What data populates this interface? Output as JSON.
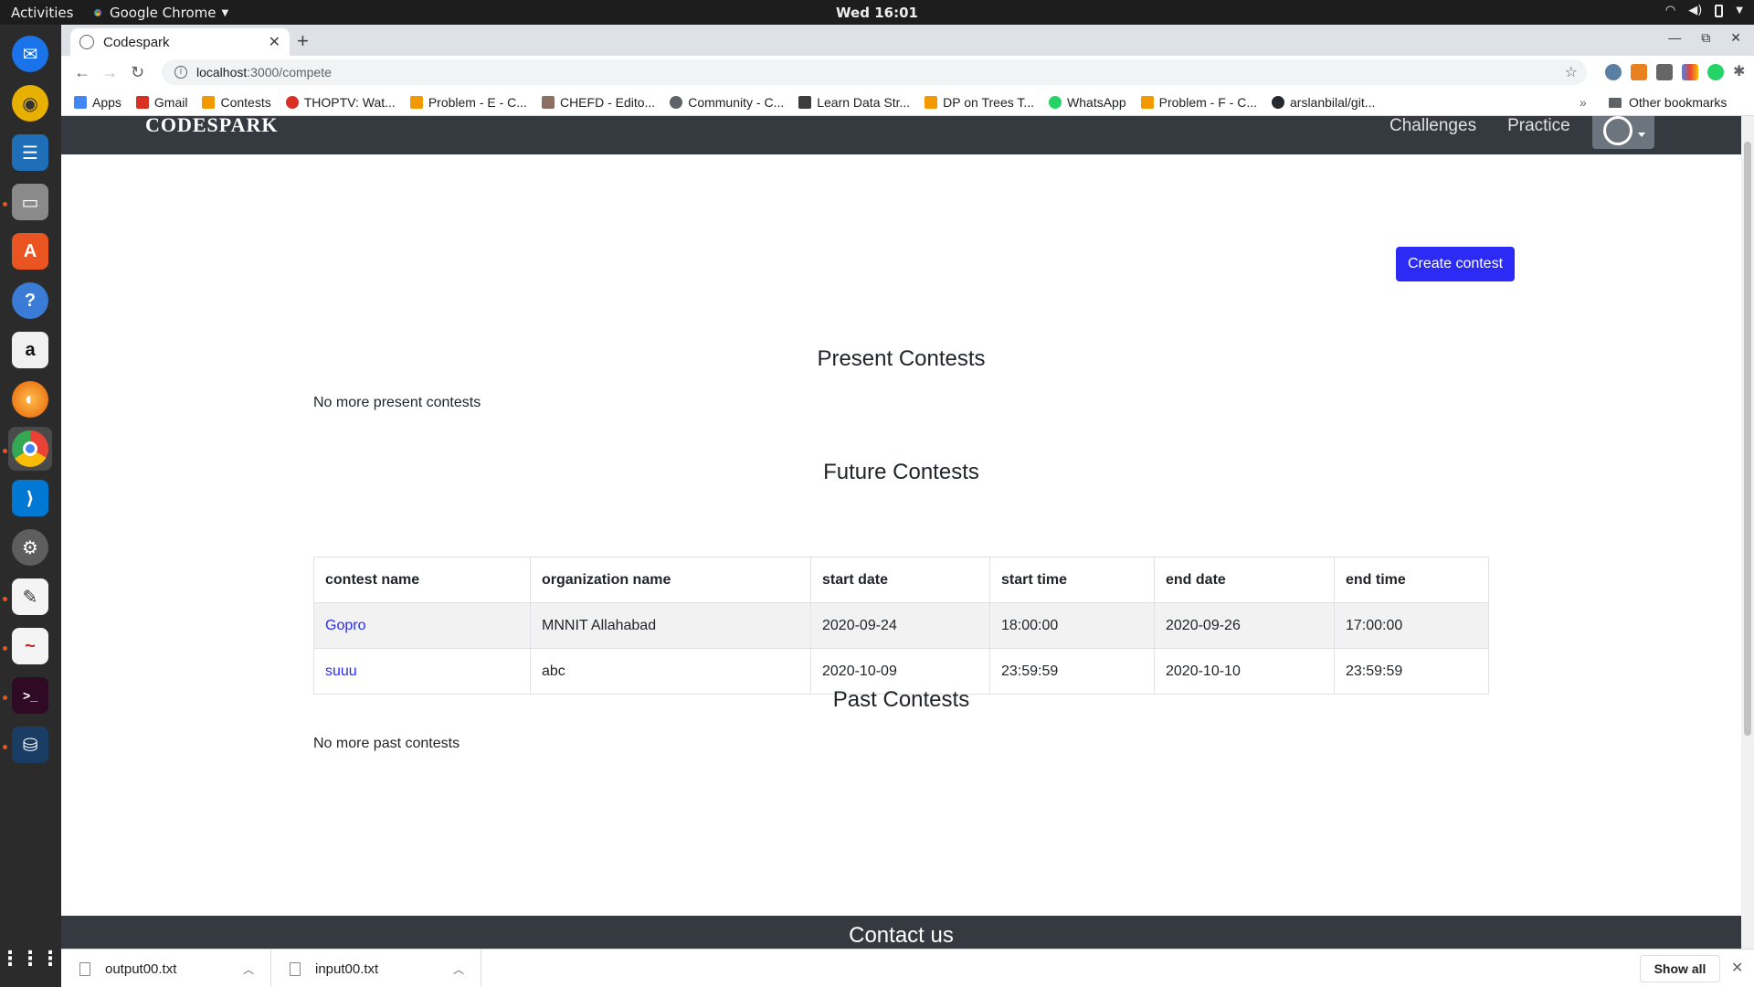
{
  "os": {
    "activities": "Activities",
    "app_name": "Google Chrome",
    "clock": "Wed 16:01"
  },
  "browser": {
    "tab_title": "Codespark",
    "url_host": "localhost",
    "url_path": ":3000/compete",
    "bookmarks": [
      {
        "label": "Apps",
        "icon": "apps-grid-icon",
        "color": "#4285f4"
      },
      {
        "label": "Gmail",
        "icon": "gmail-icon",
        "color": "#d93025"
      },
      {
        "label": "Contests",
        "icon": "bars-icon",
        "color": "#f29900"
      },
      {
        "label": "THOPTV: Wat...",
        "icon": "tv-icon",
        "color": "#d93025"
      },
      {
        "label": "Problem - E - C...",
        "icon": "bars-icon",
        "color": "#f29900"
      },
      {
        "label": "CHEFD - Edito...",
        "icon": "chef-icon",
        "color": "#8d6e63"
      },
      {
        "label": "Community - C...",
        "icon": "globe-icon",
        "color": "#5f6368"
      },
      {
        "label": "Learn Data Str...",
        "icon": "cc-icon",
        "color": "#3c3c3c"
      },
      {
        "label": "DP on Trees T...",
        "icon": "bars-icon",
        "color": "#f29900"
      },
      {
        "label": "WhatsApp",
        "icon": "whatsapp-icon",
        "color": "#25d366"
      },
      {
        "label": "Problem - F - C...",
        "icon": "bars-icon",
        "color": "#f29900"
      },
      {
        "label": "arslanbilal/git...",
        "icon": "github-icon",
        "color": "#24292e"
      }
    ],
    "bookmarks_more": "»",
    "other_bookmarks": "Other bookmarks"
  },
  "page": {
    "brand": "CODESPARK",
    "nav": {
      "challenges": "Challenges",
      "practice": "Practice"
    },
    "create_button": "Create contest",
    "present": {
      "title": "Present Contests",
      "empty": "No more present contests"
    },
    "future": {
      "title": "Future Contests",
      "columns": [
        "contest name",
        "organization name",
        "start date",
        "start time",
        "end date",
        "end time"
      ],
      "rows": [
        [
          "Gopro",
          "MNNIT Allahabad",
          "2020-09-24",
          "18:00:00",
          "2020-09-26",
          "17:00:00"
        ],
        [
          "suuu",
          "abc",
          "2020-10-09",
          "23:59:59",
          "2020-10-10",
          "23:59:59"
        ]
      ]
    },
    "past": {
      "title": "Past Contests",
      "empty": "No more past contests"
    },
    "footer": "Contact us"
  },
  "downloads": {
    "items": [
      "output00.txt",
      "input00.txt"
    ],
    "show_all": "Show all"
  },
  "colors": {
    "accent": "#2b2bf5",
    "navbar": "#343a40",
    "ubuntu_orange": "#e95420"
  }
}
